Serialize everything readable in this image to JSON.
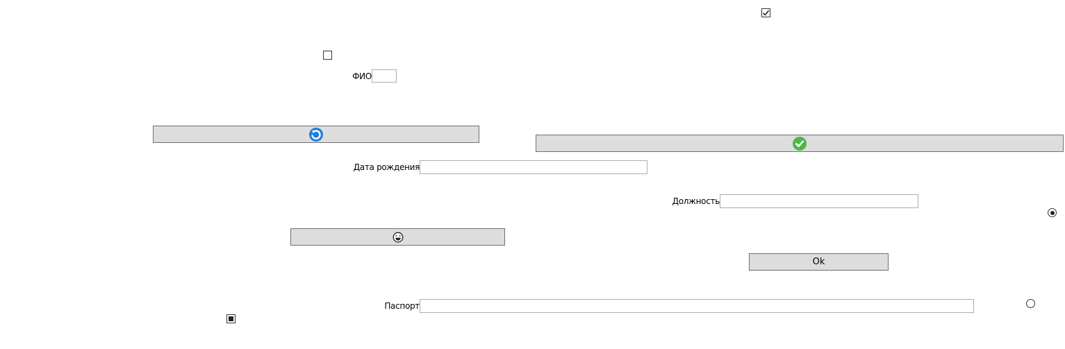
{
  "form": {
    "fio_label": "ФИО",
    "fio_value": "",
    "birth_date_label": "Дата рождения",
    "birth_date_value": "",
    "position_label": "Должность",
    "position_value": "",
    "passport_label": "Паспорт",
    "passport_value": ""
  },
  "buttons": {
    "refresh_icon": "refresh-icon",
    "confirm_icon": "check-circle-icon",
    "emoji_icon": "laughing-face-icon",
    "ok_label": "Ok"
  },
  "checkboxes": {
    "top_right_checked": true,
    "left_checked": false,
    "bottom_left_indeterminate": true
  },
  "radios": {
    "right_upper_checked": true,
    "right_lower_checked": false
  },
  "colors": {
    "button_bg": "#dddddd",
    "button_border": "#707070",
    "input_border": "#abadb3",
    "refresh_blue": "#1f7fd8",
    "confirm_green": "#4cb848"
  }
}
